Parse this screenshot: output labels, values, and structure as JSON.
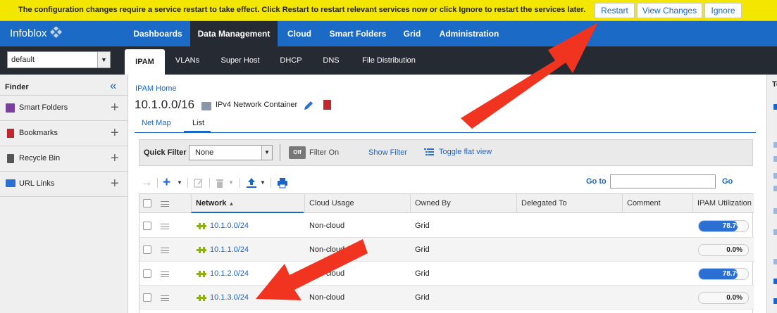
{
  "banner": {
    "message": "The configuration changes require a service restart to take effect. Click Restart to restart relevant services now or click Ignore to restart the services later.",
    "restart_label": "Restart",
    "view_changes_label": "View Changes",
    "ignore_label": "Ignore"
  },
  "brand": {
    "name": "Infoblox"
  },
  "nav": {
    "items": [
      {
        "label": "Dashboards"
      },
      {
        "label": "Data Management"
      },
      {
        "label": "Cloud"
      },
      {
        "label": "Smart Folders"
      },
      {
        "label": "Grid"
      },
      {
        "label": "Administration"
      }
    ],
    "active": "Data Management"
  },
  "network_view": {
    "value": "default"
  },
  "subnav": {
    "items": [
      {
        "label": "IPAM"
      },
      {
        "label": "VLANs"
      },
      {
        "label": "Super Host"
      },
      {
        "label": "DHCP"
      },
      {
        "label": "DNS"
      },
      {
        "label": "File Distribution"
      }
    ],
    "active": "IPAM"
  },
  "finder": {
    "title": "Finder",
    "items": [
      {
        "label": "Smart Folders"
      },
      {
        "label": "Bookmarks"
      },
      {
        "label": "Recycle Bin"
      },
      {
        "label": "URL Links"
      }
    ]
  },
  "main": {
    "breadcrumb": "IPAM Home",
    "title": "10.1.0.0/16",
    "type_label": "IPv4 Network Container",
    "tabs": [
      {
        "label": "Net Map"
      },
      {
        "label": "List"
      }
    ],
    "active_tab": "List"
  },
  "filter": {
    "quick_filter_label": "Quick Filter",
    "quick_filter_value": "None",
    "toggle_state": "Off",
    "filter_on_label": "Filter On",
    "show_filter_label": "Show Filter",
    "toggle_flat_view_label": "Toggle flat view"
  },
  "goto": {
    "label": "Go to",
    "button": "Go",
    "value": ""
  },
  "grid": {
    "columns": [
      "Network",
      "Cloud Usage",
      "Owned By",
      "Delegated To",
      "Comment",
      "IPAM Utilization"
    ],
    "sort_column": "Network",
    "rows": [
      {
        "network": "10.1.0.0/24",
        "cloud_usage": "Non-cloud",
        "owned_by": "Grid",
        "delegated_to": "",
        "comment": "",
        "utilization_label": "78.7%",
        "utilization": 78.7
      },
      {
        "network": "10.1.1.0/24",
        "cloud_usage": "Non-cloud",
        "owned_by": "Grid",
        "delegated_to": "",
        "comment": "",
        "utilization_label": "0.0%",
        "utilization": 0
      },
      {
        "network": "10.1.2.0/24",
        "cloud_usage": "Non-cloud",
        "owned_by": "Grid",
        "delegated_to": "",
        "comment": "",
        "utilization_label": "78.7%",
        "utilization": 78.7
      },
      {
        "network": "10.1.3.0/24",
        "cloud_usage": "Non-cloud",
        "owned_by": "Grid",
        "delegated_to": "",
        "comment": "",
        "utilization_label": "0.0%",
        "utilization": 0
      }
    ]
  },
  "right_panel": {
    "title": "To"
  },
  "colors": {
    "banner": "#f3e600",
    "nav": "#1a6ac6",
    "subnav": "#262b33",
    "link": "#1a66c8",
    "annotation_arrow": "#f0341f",
    "util_fill": "#2a6fd1"
  }
}
